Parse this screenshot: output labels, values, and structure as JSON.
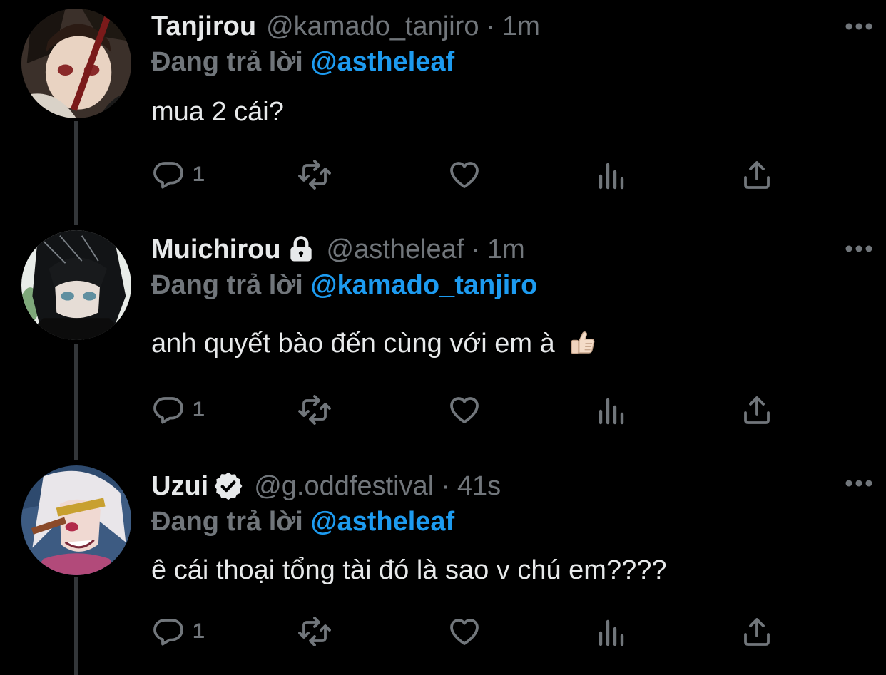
{
  "colors": {
    "background": "#000000",
    "primary_text": "#e7e9ea",
    "secondary_text": "#71767b",
    "link": "#1d9bf0",
    "thread_line": "#333639"
  },
  "tweets": [
    {
      "display_name": "Tanjirou",
      "badge": null,
      "handle": "@kamado_tanjiro",
      "separator": "·",
      "time": "1m",
      "reply_prefix": "Đang trả lời",
      "reply_target": "@astheleaf",
      "text": "mua 2 cái?",
      "emoji": null,
      "reply_count": "1"
    },
    {
      "display_name": "Muichirou",
      "badge": "lock-icon",
      "handle": "@astheleaf",
      "separator": "·",
      "time": "1m",
      "reply_prefix": "Đang trả lời",
      "reply_target": "@kamado_tanjiro",
      "text": "anh quyết bào đến cùng với em à",
      "emoji": "thumbs-up-emoji",
      "reply_count": "1"
    },
    {
      "display_name": "Uzui",
      "badge": "verified-badge-icon",
      "handle": "@g.oddfestival",
      "separator": "·",
      "time": "41s",
      "reply_prefix": "Đang trả lời",
      "reply_target": "@astheleaf",
      "text": "ê cái thoại tổng tài đó là sao v chú em????",
      "emoji": null,
      "reply_count": "1"
    }
  ],
  "icons": {
    "more": "more-horizontal-icon",
    "reply": "reply-bubble-icon",
    "retweet": "retweet-icon",
    "like": "heart-icon",
    "views": "analytics-icon",
    "share": "share-icon"
  }
}
